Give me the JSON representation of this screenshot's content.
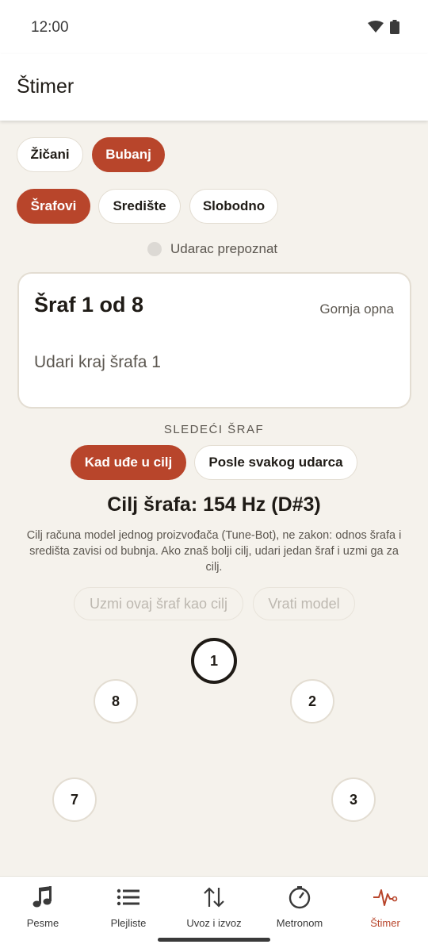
{
  "status_bar": {
    "time": "12:00"
  },
  "app_bar": {
    "title": "Štimer"
  },
  "instrument_chips": [
    {
      "label": "Žičani",
      "active": false
    },
    {
      "label": "Bubanj",
      "active": true
    }
  ],
  "mode_chips": [
    {
      "label": "Šrafovi",
      "active": true
    },
    {
      "label": "Središte",
      "active": false
    },
    {
      "label": "Slobodno",
      "active": false
    }
  ],
  "detection": {
    "label": "Udarac prepoznat"
  },
  "lug_card": {
    "title": "Šraf 1 od 8",
    "head": "Gornja opna",
    "instruction": "Udari kraj šrafa 1"
  },
  "next_lug": {
    "label": "SLEDEĆI ŠRAF",
    "options": [
      {
        "label": "Kad uđe u cilj",
        "active": true
      },
      {
        "label": "Posle svakog udarca",
        "active": false
      }
    ]
  },
  "target": {
    "title": "Cilj šrafa: 154 Hz (D#3)",
    "note": "Cilj računa model jednog proizvođača (Tune-Bot), ne zakon: odnos šrafa i središta zavisi od bubnja. Ako znaš bolji cilj, udari jedan šraf i uzmi ga za cilj."
  },
  "actions": {
    "use_as_target": "Uzmi ovaj šraf kao cilj",
    "reset_model": "Vrati model"
  },
  "lugs": [
    {
      "number": "1",
      "current": true
    },
    {
      "number": "2",
      "current": false
    },
    {
      "number": "3",
      "current": false
    },
    {
      "number": "7",
      "current": false
    },
    {
      "number": "8",
      "current": false
    }
  ],
  "bottom_nav": [
    {
      "label": "Pesme",
      "icon": "music-note-icon",
      "active": false
    },
    {
      "label": "Plejliste",
      "icon": "list-icon",
      "active": false
    },
    {
      "label": "Uvoz i izvoz",
      "icon": "import-export-icon",
      "active": false
    },
    {
      "label": "Metronom",
      "icon": "metronome-icon",
      "active": false
    },
    {
      "label": "Štimer",
      "icon": "pulse-icon",
      "active": true
    }
  ],
  "colors": {
    "accent": "#b8452b",
    "background": "#f5f2ec"
  }
}
